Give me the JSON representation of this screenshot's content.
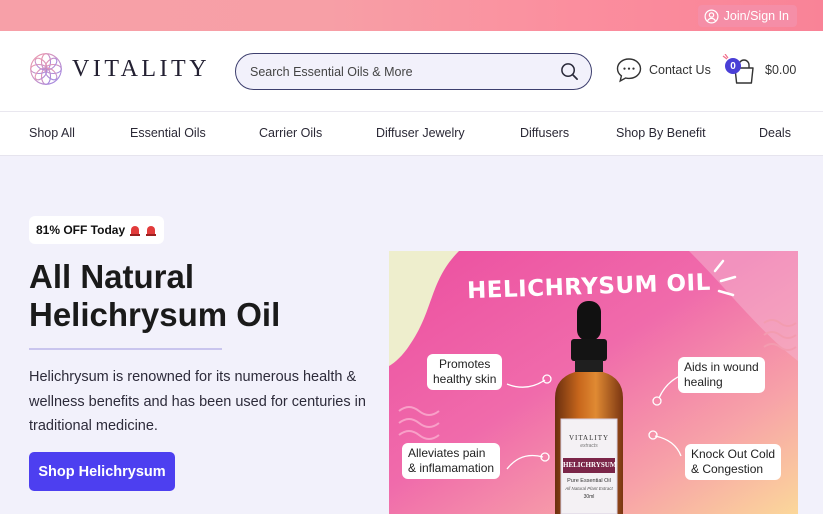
{
  "topbar": {
    "join_label": "Join/Sign In",
    "join_icon": "user-circle-icon"
  },
  "header": {
    "logo_text": "VITALITY",
    "search_placeholder": "Search Essential Oils & More",
    "contact_label": "Contact Us",
    "cart_count": "0",
    "cart_total": "$0.00"
  },
  "nav": {
    "items": [
      "Shop All",
      "Essential Oils",
      "Carrier Oils",
      "Diffuser Jewelry",
      "Diffusers",
      "Shop By Benefit",
      "Deals"
    ]
  },
  "hero": {
    "badge": "81% OFF Today",
    "title_line1": "All Natural",
    "title_line2": "Helichrysum Oil",
    "description": "Helichrysum is renowned for its numerous health & wellness benefits and has been used for centuries in traditional medicine.",
    "cta_label": "Shop Helichrysum"
  },
  "product_image": {
    "headline": "HELICHRYSUM OIL",
    "callouts": [
      "Promotes healthy skin",
      "Aids in wound healing",
      "Alleviates pain & inflamamation",
      "Knock Out Cold & Congestion"
    ],
    "callout_lines": {
      "promotes": [
        "Promotes",
        "healthy skin"
      ],
      "aids": [
        "Aids in wound",
        "healing"
      ],
      "alleviates": [
        "Alleviates pain",
        "& inflamamation"
      ],
      "knock": [
        "Knock Out Cold",
        "& Congestion"
      ]
    },
    "bottle_brand": "VITALITY",
    "bottle_brand_sub": "extracts",
    "bottle_label": "HELICHRYSUM",
    "bottle_type": "Pure Essential Oil",
    "bottle_note": "All Natural Plant Extract",
    "bottle_volume": "30ml"
  },
  "colors": {
    "accent": "#4d3ff0",
    "topbar": "#f98e9e",
    "page_bg": "#f2f1fb"
  }
}
